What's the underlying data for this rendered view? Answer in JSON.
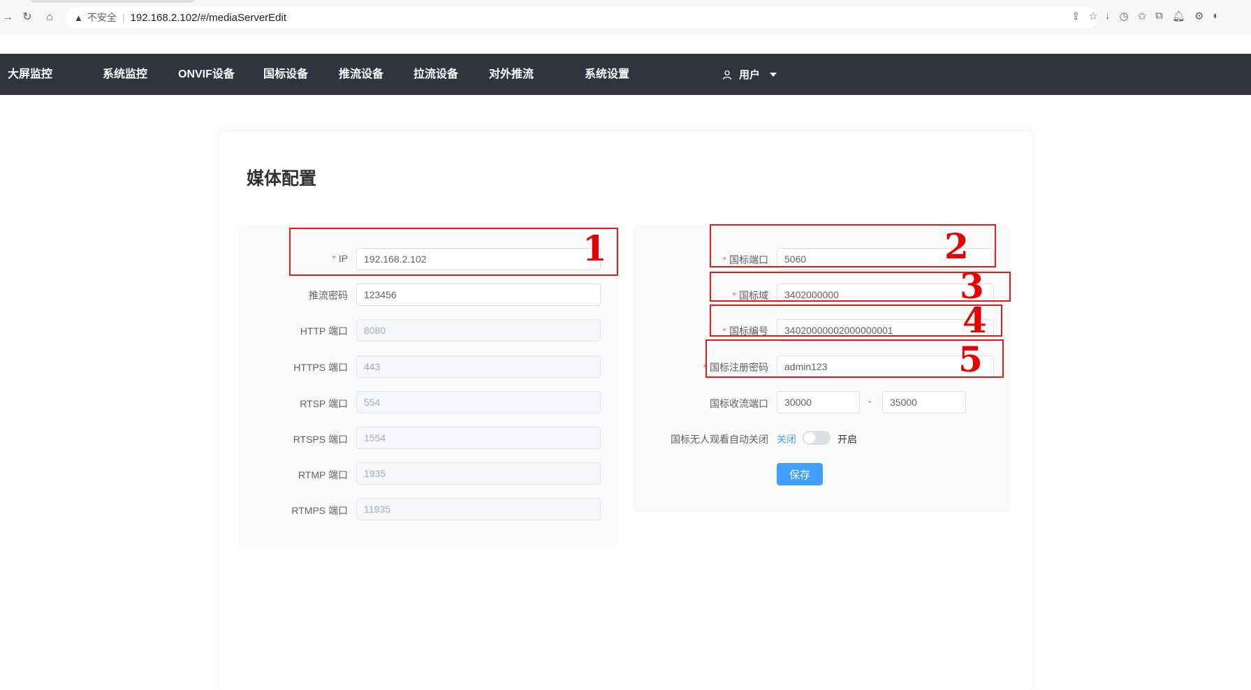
{
  "browser": {
    "insecure_label": "不安全",
    "url": "192.168.2.102/#/mediaServerEdit"
  },
  "nav": {
    "items": [
      "大屏监控",
      "系统监控",
      "ONVIF设备",
      "国标设备",
      "推流设备",
      "拉流设备",
      "对外推流",
      "系统设置"
    ],
    "user_label": "用户"
  },
  "page": {
    "title": "媒体配置"
  },
  "left_form": {
    "ip_label": "IP",
    "ip_value": "192.168.2.102",
    "push_secret_label": "推流密码",
    "push_secret_value": "123456",
    "http_label": "HTTP 端口",
    "http_value": "8080",
    "https_label": "HTTPS 端口",
    "https_value": "443",
    "rtsp_label": "RTSP 端口",
    "rtsp_value": "554",
    "rtsps_label": "RTSPS 端口",
    "rtsps_value": "1554",
    "rtmp_label": "RTMP 端口",
    "rtmp_value": "1935",
    "rtmps_label": "RTMPS 端口",
    "rtmps_value": "11935"
  },
  "right_form": {
    "sip_port_label": "国标端口",
    "sip_port_value": "5060",
    "sip_domain_label": "国标域",
    "sip_domain_value": "3402000000",
    "sip_id_label": "国标编号",
    "sip_id_value": "34020000002000000001",
    "sip_password_label": "国标注册密码",
    "sip_password_value": "admin123",
    "rtp_range_label": "国标收流端口",
    "rtp_range_start": "30000",
    "rtp_range_sep": "-",
    "rtp_range_end": "35000",
    "auto_close_label": "国标无人观看自动关闭",
    "switch_off_label": "关闭",
    "switch_on_label": "开启",
    "switch_state": "off",
    "save_label": "保存"
  },
  "annotations": [
    "1",
    "2",
    "3",
    "4",
    "5"
  ],
  "colors": {
    "nav_bg": "#2f3440",
    "primary": "#409eff",
    "required": "#f56c6c",
    "annotation": "#e21a1a"
  }
}
